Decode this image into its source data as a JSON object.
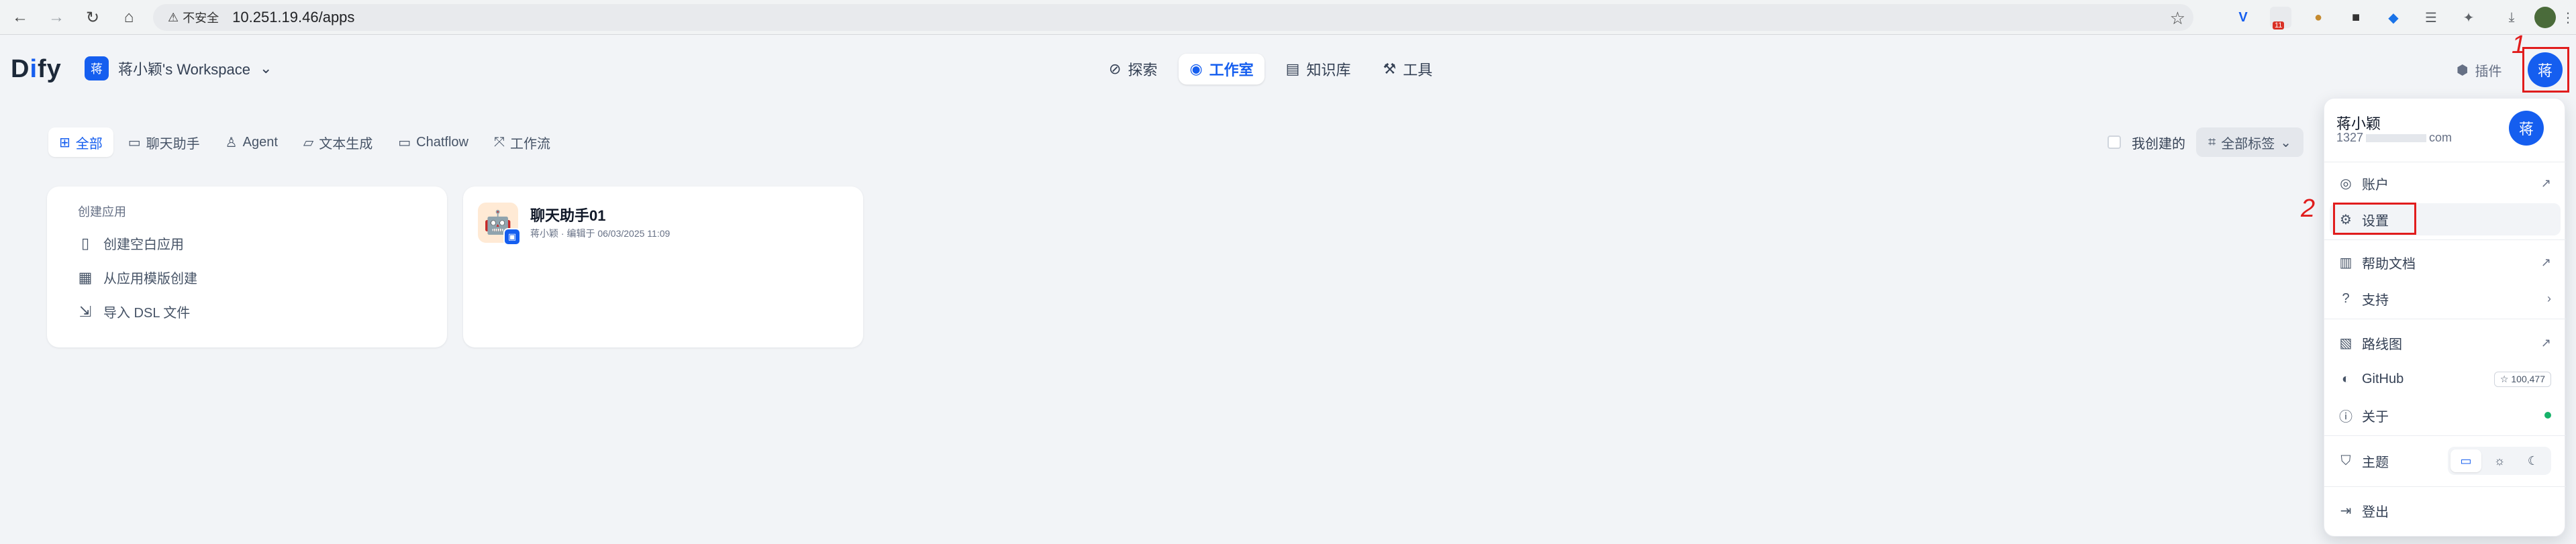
{
  "browser": {
    "back_icon": "←",
    "forward_icon": "→",
    "reload_icon": "↻",
    "home_icon": "⌂",
    "security_label": "不安全",
    "url": "10.251.19.46/apps",
    "bookmark_icon": "☆",
    "extensions_badge": "11"
  },
  "header": {
    "logo_prefix": "D",
    "logo_i": "i",
    "logo_suffix": "fy",
    "workspace_avatar": "蒋",
    "workspace_name": "蒋小颖's Workspace",
    "nav": [
      {
        "label": "探索"
      },
      {
        "label": "工作室"
      },
      {
        "label": "知识库"
      },
      {
        "label": "工具"
      }
    ],
    "plugin_label": "插件",
    "user_avatar": "蒋",
    "annotation_1": "1"
  },
  "filters": {
    "tabs": [
      {
        "label": "全部"
      },
      {
        "label": "聊天助手"
      },
      {
        "label": "Agent"
      },
      {
        "label": "文本生成"
      },
      {
        "label": "Chatflow"
      },
      {
        "label": "工作流"
      }
    ],
    "created_by_me": "我创建的",
    "all_tags": "全部标签"
  },
  "create_card": {
    "title": "创建应用",
    "items": [
      {
        "label": "创建空白应用"
      },
      {
        "label": "从应用模版创建"
      },
      {
        "label": "导入 DSL 文件"
      }
    ]
  },
  "app_card": {
    "name": "聊天助手01",
    "meta": "蒋小颖 · 编辑于 06/03/2025 11:09"
  },
  "dropdown": {
    "user_name": "蒋小颖",
    "email": "1327",
    "email_suffix": "com",
    "avatar": "蒋",
    "items": {
      "account": "账户",
      "settings": "设置",
      "help_docs": "帮助文档",
      "support": "支持",
      "roadmap": "路线图",
      "github": "GitHub",
      "github_stars": "100,477",
      "about": "关于",
      "theme": "主题",
      "logout": "登出"
    },
    "annotation_2": "2"
  }
}
